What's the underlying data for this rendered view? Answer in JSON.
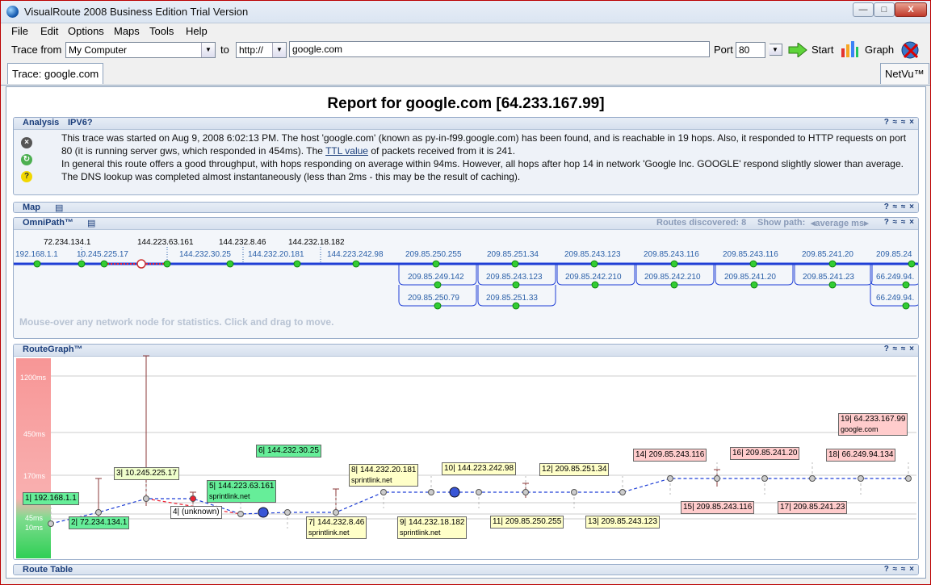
{
  "window": {
    "title": "VisualRoute 2008 Business Edition Trial Version",
    "btn_min": "—",
    "btn_max": "□",
    "btn_close": "X"
  },
  "menu": [
    "File",
    "Edit",
    "Options",
    "Maps",
    "Tools",
    "Help"
  ],
  "toolbar": {
    "trace_from_label": "Trace from",
    "trace_from_value": "My Computer",
    "to_label": "to",
    "protocol_value": "http://",
    "target_value": "google.com",
    "port_label": "Port",
    "port_value": "80",
    "start_label": "Start",
    "graph_label": "Graph"
  },
  "tabs": {
    "active": "Trace:  google.com",
    "right": "NetVu™"
  },
  "report_title": "Report for google.com [64.233.167.99]",
  "analysis": {
    "title": "Analysis",
    "ipv6": "IPV6?",
    "line1": "This trace was started on Aug 9, 2008 6:02:13 PM. The host 'google.com' (known as py-in-f99.google.com) has been found, and is reachable in 19 hops. Also, it responded to HTTP requests on port 80 (it is running server gws, which responded in 454ms). The ",
    "ttl_link": "TTL value",
    "line1b": " of packets received from it is 241.",
    "line2": "In general this route offers a good throughput, with hops responding on average within 94ms. However, all hops after hop 14 in network 'Google Inc. GOOGLE' respond slightly slower than average. The DNS lookup was completed almost instantaneously (less than 2ms - this may be the result of caching)."
  },
  "map": {
    "title": "Map"
  },
  "omnipath": {
    "title": "OmniPath™",
    "routes_discovered": "Routes discovered: 8",
    "show_path": "Show path:",
    "show_path_value": "average ms",
    "hint": "Mouse-over any network node for statistics. Click and drag to move.",
    "top_labels": [
      "72.234.134.1",
      "144.223.63.161",
      "144.232.8.46",
      "144.232.18.182"
    ],
    "main_labels": [
      "192.168.1.1",
      "10.245.225.17",
      "144.232.30.25",
      "144.232.20.181",
      "144.223.242.98",
      "209.85.250.255",
      "209.85.251.34",
      "209.85.243.123",
      "209.85.243.116",
      "209.85.243.116",
      "209.85.241.20",
      "209.85.24"
    ],
    "alt_row1": [
      "209.85.249.142",
      "209.85.243.123",
      "209.85.242.210",
      "209.85.242.210",
      "209.85.241.20",
      "209.85.241.23",
      "66.249.94."
    ],
    "alt_row2": [
      "209.85.250.79",
      "209.85.251.33",
      "66.249.94."
    ]
  },
  "routegraph": {
    "title": "RouteGraph™",
    "yticks": [
      "1200ms",
      "450ms",
      "170ms",
      "45ms",
      "10ms"
    ],
    "hops": [
      {
        "label": "1| 192.168.1.1",
        "sub": ""
      },
      {
        "label": "2| 72.234.134.1",
        "sub": ""
      },
      {
        "label": "3| 10.245.225.17",
        "sub": ""
      },
      {
        "label": "4| (unknown)",
        "sub": ""
      },
      {
        "label": "5| 144.223.63.161",
        "sub": "sprintlink.net"
      },
      {
        "label": "6| 144.232.30.25",
        "sub": ""
      },
      {
        "label": "7| 144.232.8.46",
        "sub": "sprintlink.net"
      },
      {
        "label": "8| 144.232.20.181",
        "sub": "sprintlink.net"
      },
      {
        "label": "9| 144.232.18.182",
        "sub": "sprintlink.net"
      },
      {
        "label": "10| 144.223.242.98",
        "sub": ""
      },
      {
        "label": "11| 209.85.250.255",
        "sub": ""
      },
      {
        "label": "12| 209.85.251.34",
        "sub": ""
      },
      {
        "label": "13| 209.85.243.123",
        "sub": ""
      },
      {
        "label": "14| 209.85.243.116",
        "sub": ""
      },
      {
        "label": "15| 209.85.243.116",
        "sub": ""
      },
      {
        "label": "16| 209.85.241.20",
        "sub": ""
      },
      {
        "label": "17| 209.85.241.23",
        "sub": ""
      },
      {
        "label": "18| 66.249.94.134",
        "sub": ""
      },
      {
        "label": "19| 64.233.167.99",
        "sub": "google.com"
      }
    ]
  },
  "route_table": {
    "title": "Route Table"
  },
  "panel_controls": "? ≈ ≈ ×",
  "colors": {
    "accent": "#1a3d7a",
    "path_blue": "#1f3fd6",
    "green_box": "#66ee99",
    "yellow_box": "#ffffc8",
    "pink_box": "#ffcccc"
  }
}
